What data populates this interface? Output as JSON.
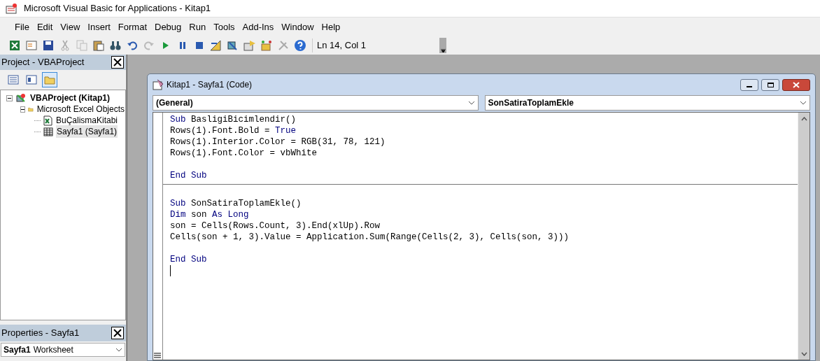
{
  "window": {
    "title": "Microsoft Visual Basic for Applications - Kitap1"
  },
  "menu": [
    "File",
    "Edit",
    "View",
    "Insert",
    "Format",
    "Debug",
    "Run",
    "Tools",
    "Add-Ins",
    "Window",
    "Help"
  ],
  "toolbar": {
    "position": "Ln 14, Col 1"
  },
  "project_panel": {
    "title": "Project - VBAProject",
    "tree": [
      {
        "label": "VBAProject (Kitap1)",
        "kind": "project",
        "expanded": true,
        "selected": false,
        "children": [
          {
            "label": "Microsoft Excel Objects",
            "kind": "folder",
            "expanded": true,
            "selected": false,
            "children": [
              {
                "label": "BuÇalismaKitabi",
                "kind": "workbook",
                "selected": false
              },
              {
                "label": "Sayfa1 (Sayfa1)",
                "kind": "sheet",
                "selected": true
              }
            ]
          }
        ]
      }
    ]
  },
  "properties_panel": {
    "title": "Properties - Sayfa1",
    "object_name": "Sayfa1",
    "object_type": "Worksheet"
  },
  "code_window": {
    "title": "Kitap1 - Sayfa1 (Code)",
    "object_dropdown": "(General)",
    "procedure_dropdown": "SonSatiraToplamEkle",
    "procedures": [
      {
        "lines": [
          {
            "kind": "code",
            "segments": [
              {
                "kind": "keyword",
                "text": "Sub"
              },
              {
                "kind": "plain",
                "text": " BasligiBicimlendir()"
              }
            ]
          },
          {
            "kind": "code",
            "segments": [
              {
                "kind": "plain",
                "text": "Rows(1).Font.Bold = "
              },
              {
                "kind": "keyword",
                "text": "True"
              }
            ]
          },
          {
            "kind": "code",
            "segments": [
              {
                "kind": "plain",
                "text": "Rows(1).Interior.Color = RGB(31, 78, 121)"
              }
            ]
          },
          {
            "kind": "code",
            "segments": [
              {
                "kind": "plain",
                "text": "Rows(1).Font.Color = vbWhite"
              }
            ]
          },
          {
            "kind": "blank"
          },
          {
            "kind": "code",
            "segments": [
              {
                "kind": "keyword",
                "text": "End Sub"
              }
            ]
          }
        ]
      },
      {
        "lines": [
          {
            "kind": "blank"
          },
          {
            "kind": "code",
            "segments": [
              {
                "kind": "keyword",
                "text": "Sub"
              },
              {
                "kind": "plain",
                "text": " SonSatiraToplamEkle()"
              }
            ]
          },
          {
            "kind": "code",
            "segments": [
              {
                "kind": "keyword",
                "text": "Dim"
              },
              {
                "kind": "plain",
                "text": " son "
              },
              {
                "kind": "keyword",
                "text": "As Long"
              }
            ]
          },
          {
            "kind": "code",
            "segments": [
              {
                "kind": "plain",
                "text": "son = Cells(Rows.Count, 3).End(xlUp).Row"
              }
            ]
          },
          {
            "kind": "code",
            "segments": [
              {
                "kind": "plain",
                "text": "Cells(son + 1, 3).Value = Application.Sum(Range(Cells(2, 3), Cells(son, 3)))"
              }
            ]
          },
          {
            "kind": "blank"
          },
          {
            "kind": "code",
            "segments": [
              {
                "kind": "keyword",
                "text": "End Sub"
              }
            ]
          }
        ]
      }
    ]
  }
}
